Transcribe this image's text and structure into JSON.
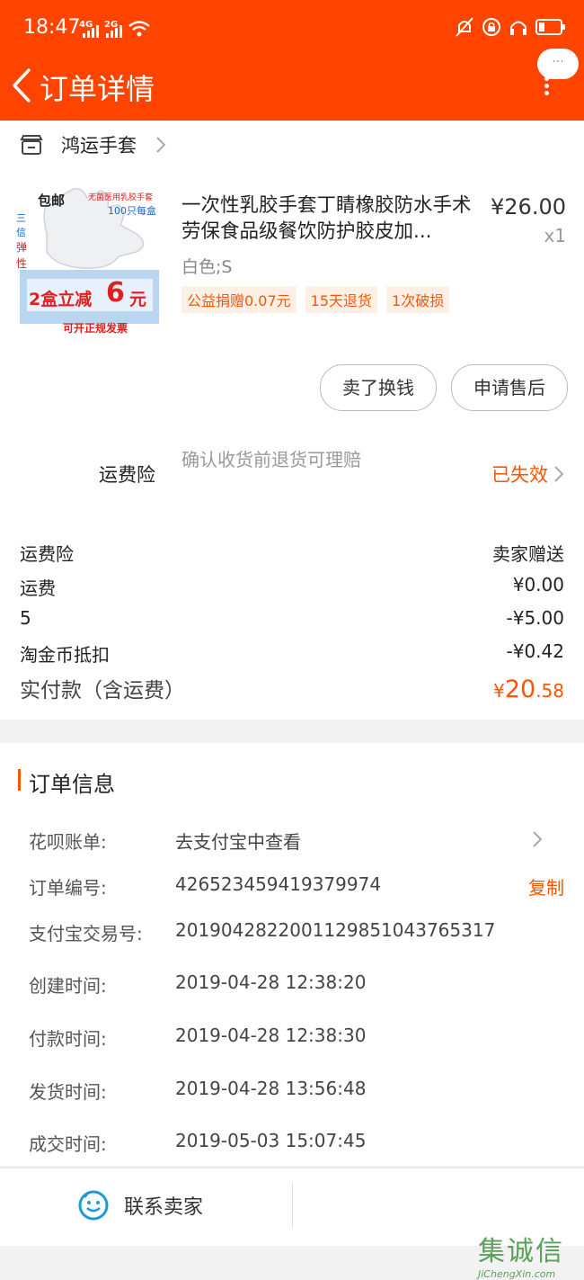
{
  "status_bar": {
    "time": "18:47",
    "net1": "4G",
    "net2": "2G"
  },
  "nav": {
    "title": "订单详情",
    "bubble": "···"
  },
  "shop": {
    "name": "鸿运手套"
  },
  "product": {
    "title": "一次性乳胶手套丁睛橡胶防水手术劳保食品级餐饮防护胶皮加...",
    "price": "¥26.00",
    "qty": "x1",
    "spec": "白色;S",
    "tags": [
      "公益捐赠0.07元",
      "15天退货",
      "1次破损"
    ],
    "image_text": {
      "a": "包邮",
      "b": "无菌医用乳胶手套",
      "c": "100只每盒",
      "d": "三",
      "e": "信",
      "f": "弹",
      "g": "性",
      "h": "2盒立减",
      "i": "6",
      "j": "元",
      "k": "可开正规发票"
    }
  },
  "actions": {
    "sell": "卖了换钱",
    "after_sale": "申请售后"
  },
  "insurance": {
    "label": "运费险",
    "desc": "确认收货前退货可理赔",
    "status": "已失效"
  },
  "fees": [
    {
      "label": "运费险",
      "value": "卖家赠送"
    },
    {
      "label": "运费",
      "value": "¥0.00"
    },
    {
      "label": "5",
      "value": "-¥5.00"
    },
    {
      "label": "淘金币抵扣",
      "value": "-¥0.42"
    }
  ],
  "total": {
    "label": "实付款（含运费）",
    "currency": "¥",
    "int": "20",
    "dec": ".58"
  },
  "order_info": {
    "title": "订单信息",
    "rows": [
      {
        "k": "花呗账单:",
        "v": "去支付宝中查看"
      },
      {
        "k": "订单编号:",
        "v": "426523459419379974"
      },
      {
        "k": "支付宝交易号:",
        "v": "2019042822001129851043765317"
      },
      {
        "k": "创建时间:",
        "v": "2019-04-28 12:38:20"
      },
      {
        "k": "付款时间:",
        "v": "2019-04-28 12:38:30"
      },
      {
        "k": "发货时间:",
        "v": "2019-04-28 13:56:48"
      },
      {
        "k": "成交时间:",
        "v": "2019-05-03 15:07:45"
      }
    ],
    "copy": "复制"
  },
  "contact": {
    "label": "联系卖家"
  },
  "watermark": {
    "cn": "集诚信",
    "url": "JiChengXin.com"
  },
  "colors": {
    "accent": "#ff4400",
    "orange_text": "#ff5500"
  }
}
